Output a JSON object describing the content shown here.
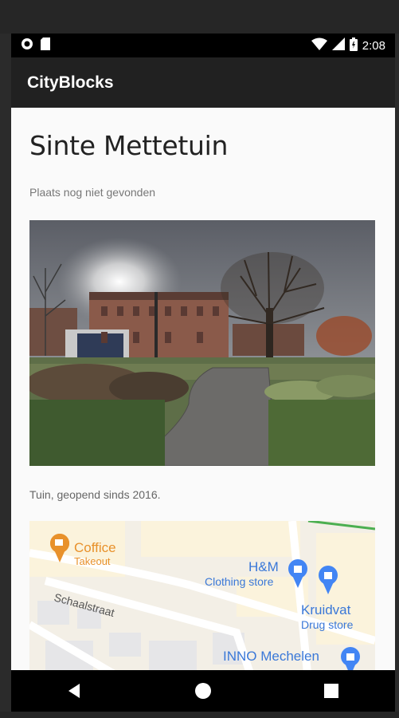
{
  "status_bar": {
    "time": "2:08",
    "left_icons": [
      "notification-circle-icon",
      "sd-card-icon"
    ],
    "right_icons": [
      "wifi-icon",
      "signal-icon",
      "battery-icon"
    ]
  },
  "app_bar": {
    "title": "CityBlocks"
  },
  "place": {
    "title": "Sinte Mettetuin",
    "status": "Plaats nog niet gevonden",
    "photo_icon": "garden-photo",
    "caption": "Tuin, geopend sinds 2016."
  },
  "map": {
    "pois": [
      {
        "name": "Coffice",
        "category": "Takeout",
        "icon": "coffee-pin-icon",
        "color": "#e8912b"
      },
      {
        "name": "H&M",
        "category": "Clothing store",
        "icon": "shopping-bag-pin-icon",
        "color": "#4285f4"
      },
      {
        "name": "Kruidvat",
        "category": "Drug store",
        "icon": "shopping-bag-pin-icon",
        "color": "#4285f4"
      },
      {
        "name": "INNO Mechelen",
        "category": "",
        "icon": "shopping-bag-pin-icon",
        "color": "#4285f4"
      }
    ],
    "street": "Schaalstraat"
  },
  "nav_bar": {
    "icons": [
      "back-icon",
      "home-icon",
      "recents-icon"
    ]
  }
}
